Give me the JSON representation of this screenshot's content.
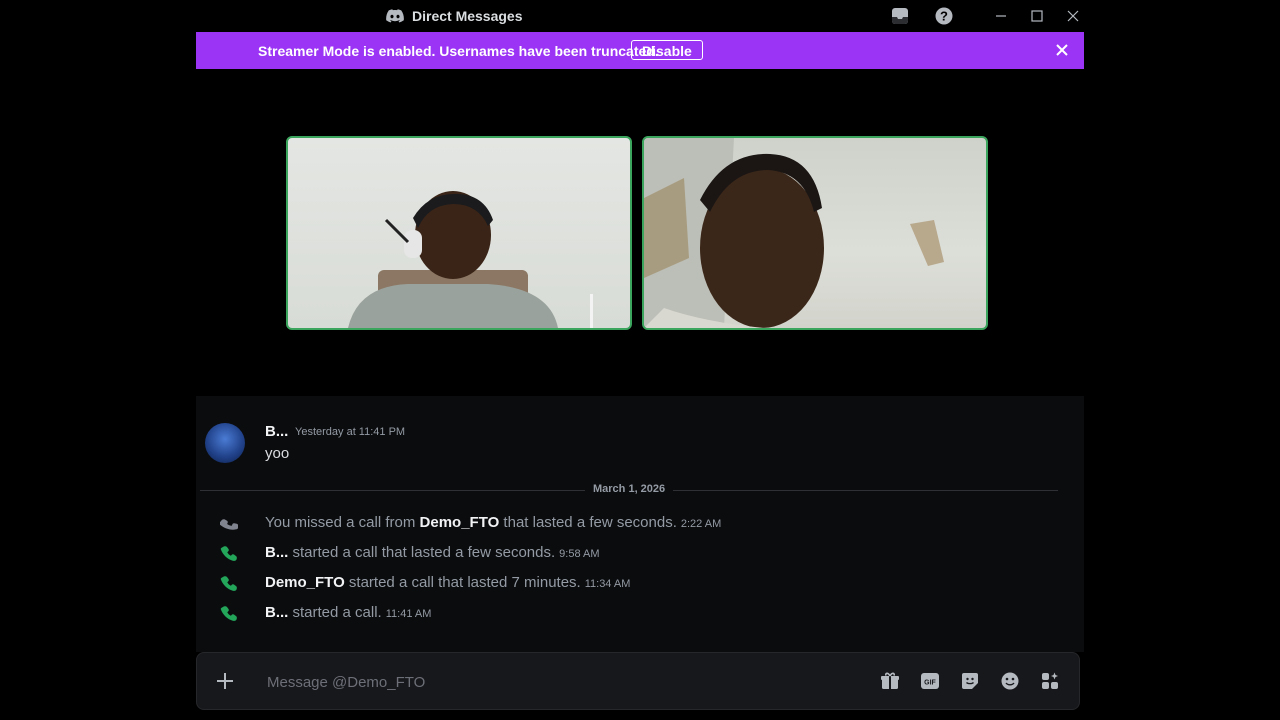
{
  "window": {
    "title": "Direct Messages",
    "icons": [
      "discord-logo-icon",
      "inbox-icon",
      "help-icon",
      "minimize-icon",
      "maximize-icon",
      "close-icon"
    ]
  },
  "banner": {
    "text": "Streamer Mode is enabled. Usernames have been truncated.",
    "button_label": "Disable",
    "color": "#9b34f5"
  },
  "call": {
    "speaking_border_color": "#3ba55d",
    "tiles": [
      "video-tile-self",
      "video-tile-other"
    ]
  },
  "messages": [
    {
      "author": "B...",
      "timestamp": "Yesterday at 11:41 PM",
      "text": "yoo"
    }
  ],
  "date_divider": "March 1, 2026",
  "system_messages": [
    {
      "icon": "missed-call-icon",
      "pre": "You missed a call from ",
      "bold": "Demo_FTO",
      "post": " that lasted a few seconds.",
      "time": "2:22 AM"
    },
    {
      "icon": "call-icon",
      "pre": "",
      "bold": "B...",
      "post": " started a call that lasted a few seconds.",
      "time": "9:58 AM"
    },
    {
      "icon": "call-icon",
      "pre": "",
      "bold": "Demo_FTO",
      "post": " started a call that lasted 7 minutes.",
      "time": "11:34 AM"
    },
    {
      "icon": "call-icon",
      "pre": "",
      "bold": "B...",
      "post": " started a call.",
      "time": "11:41 AM"
    }
  ],
  "composer": {
    "placeholder": "Message @Demo_FTO",
    "icons": [
      "gift-icon",
      "gif-icon",
      "sticker-icon",
      "emoji-icon",
      "apps-icon"
    ]
  }
}
